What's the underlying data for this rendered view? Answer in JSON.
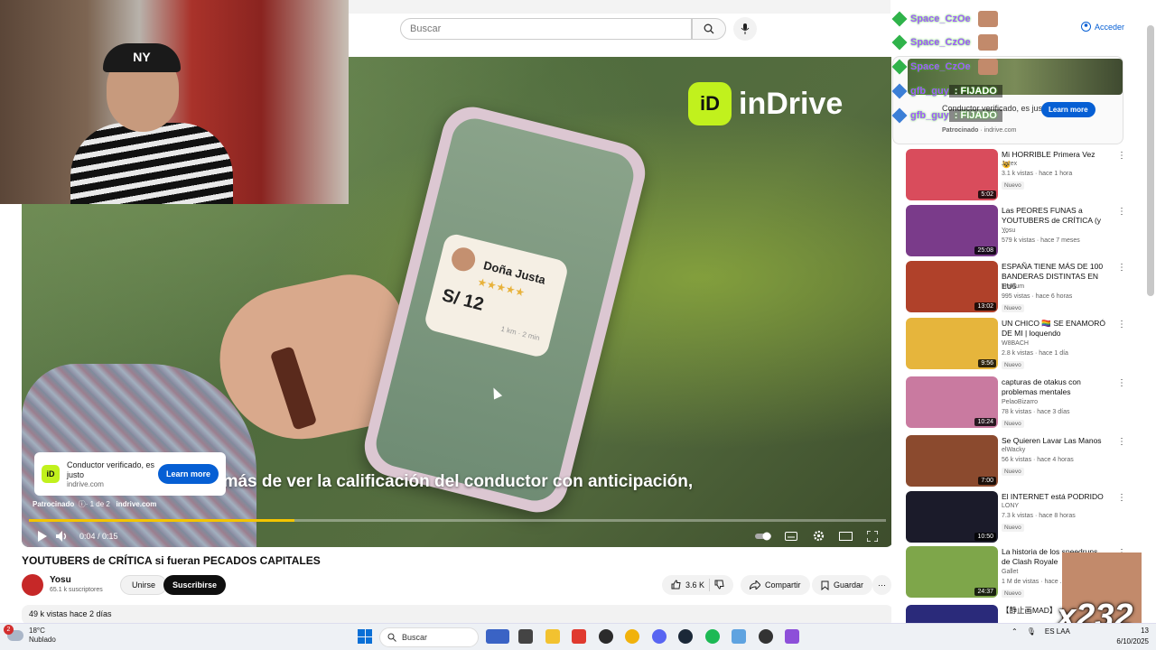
{
  "header": {
    "search_placeholder": "Buscar",
    "search_icon": "search-icon",
    "mic_icon": "mic-icon"
  },
  "video": {
    "brand": "inDrive",
    "brand_logo_letter": "iD",
    "driver_name": "Doña Justa",
    "driver_stars": "★★★★★",
    "driver_price": "S/ 12",
    "driver_eta": "1 km · 2 min",
    "subtitle": "emás de ver la calificación del conductor con anticipación,",
    "ad": {
      "title": "Conductor verificado, es justo",
      "url": "indrive.com",
      "learn_more": "Learn more",
      "sponsored": "Patrocinado",
      "position": "1 de 2",
      "sponsored_url": "indrive.com"
    },
    "time": "0:04 / 0:15",
    "progress_fraction": 0.31,
    "accent": "#f3c400"
  },
  "info": {
    "title": "YOUTUBERS de CRÍTICA si fueran PECADOS CAPITALES",
    "channel": "Yosu",
    "subs": "65.1 k suscriptores",
    "join": "Unirse",
    "subscribe": "Suscribirse",
    "likes": "3.6 K",
    "share": "Compartir",
    "save": "Guardar",
    "views": "49 k vistas  hace 2 días"
  },
  "sidebar": {
    "acceder": "Acceder",
    "chat": [
      {
        "user": "Space_CzOe",
        "text": ""
      },
      {
        "user": "Space_CzOe",
        "text": ""
      },
      {
        "user": "Space_CzOe",
        "text": ""
      },
      {
        "user": "gfb_guy",
        "text": ": FIJADO"
      },
      {
        "user": "gfb_guy",
        "text": ": FIJADO"
      }
    ],
    "ad": {
      "title": "Conductor verificado, es justo",
      "sponsored": "Patrocinado",
      "url": "indrive.com",
      "learn_more": "Learn more"
    },
    "recommendations": [
      {
        "title": "Mi HORRIBLE Primera Vez 😺",
        "channel": "Jarex",
        "meta": "3.1 k vistas · hace 1 hora",
        "new": "Nuevo",
        "duration": "5:02",
        "color": "#d94c5c"
      },
      {
        "title": "Las PEORES FUNAS a YOUTUBERS de CRÍTICA (y ...",
        "channel": "Yosu",
        "meta": "579 k vistas · hace 7 meses",
        "new": "",
        "duration": "25:08",
        "color": "#7a3b8a"
      },
      {
        "title": "ESPAÑA TIENE MÁS DE 100 BANDERAS DISTINTAS EN EU5",
        "channel": "Traxium",
        "meta": "995 vistas · hace 6 horas",
        "new": "Nuevo",
        "duration": "13:02",
        "color": "#b0412a"
      },
      {
        "title": "UN CHICO 🏳️‍🌈 SE ENAMORÓ DE MI   | loquendo",
        "channel": "W8BACH",
        "meta": "2.8 k vistas · hace 1 día",
        "new": "Nuevo",
        "duration": "9:56",
        "color": "#e6b53c"
      },
      {
        "title": "capturas de otakus con problemas mentales",
        "channel": "PelaoBizarro",
        "meta": "78 k vistas · hace 3 días",
        "new": "Nuevo",
        "duration": "10:24",
        "color": "#c97aa0"
      },
      {
        "title": "Se Quieren Lavar Las Manos",
        "channel": "elWacky",
        "meta": "56 k vistas · hace 4 horas",
        "new": "Nuevo",
        "duration": "7:00",
        "color": "#8b4a2e"
      },
      {
        "title": "El INTERNET está PODRIDO",
        "channel": "LONY",
        "meta": "7.3 k vistas · hace 8 horas",
        "new": "Nuevo",
        "duration": "10:50",
        "color": "#1b1b2a"
      },
      {
        "title": "La historia de los speedruns de Clash Royale",
        "channel": "Gallet",
        "meta": "1 M de vistas · hace ...",
        "new": "Nuevo",
        "duration": "24:37",
        "color": "#7ea64a"
      },
      {
        "title": "【静止画MAD】 ...",
        "channel": "",
        "meta": "",
        "new": "",
        "duration": "",
        "color": "#2a2a7a"
      }
    ]
  },
  "overlay": {
    "cam_cap_text": "NY",
    "counter": "x232"
  },
  "taskbar": {
    "temp": "18°C",
    "weather": "Nublado",
    "weather_badge": "2",
    "search": "Buscar",
    "lang": "ES LAA",
    "time": "13",
    "date": "6/10/2025"
  }
}
